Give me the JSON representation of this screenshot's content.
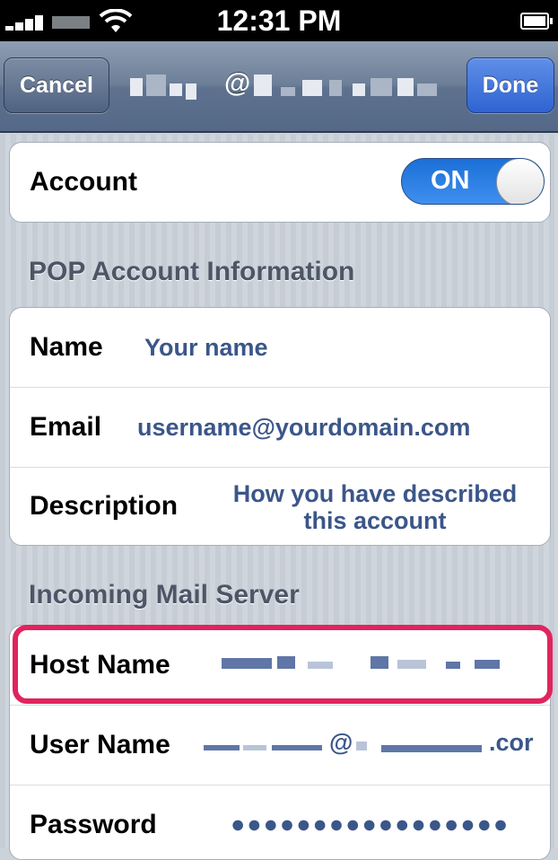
{
  "status_bar": {
    "time": "12:31 PM",
    "icons": [
      "signal-icon",
      "wifi-icon",
      "battery-icon"
    ]
  },
  "nav": {
    "cancel_label": "Cancel",
    "title_visible_char": "@",
    "done_label": "Done"
  },
  "account": {
    "label": "Account",
    "toggle_label": "ON"
  },
  "pop_section": {
    "header": "POP Account Information",
    "rows": [
      {
        "label": "Name",
        "value": "Your name"
      },
      {
        "label": "Email",
        "value": "username@yourdomain.com"
      },
      {
        "label": "Description",
        "value_line1": "How you have described",
        "value_line2": "this account"
      }
    ]
  },
  "incoming_section": {
    "header": "Incoming Mail Server",
    "host_name_label": "Host Name",
    "user_name_label": "User Name",
    "user_name_visible_at": "@",
    "user_name_visible_tail": ".cor",
    "password_label": "Password",
    "password_value": "●●●●●●●●●●●●●●●●●"
  },
  "colors": {
    "nav_gradient_top": "#8e9db2",
    "done_button": "#2f63d1",
    "value_text": "#3b5689",
    "highlight": "#e0245e",
    "toggle_on": "#1b6fd6"
  }
}
